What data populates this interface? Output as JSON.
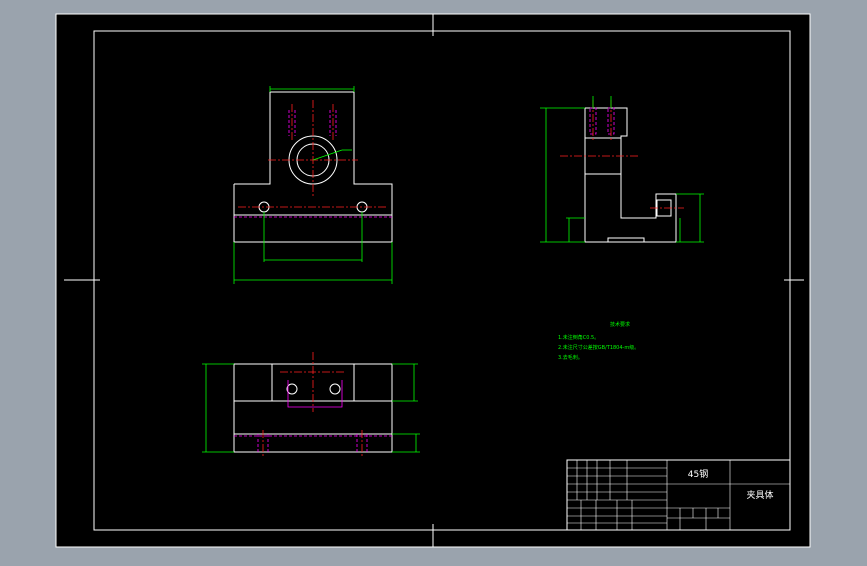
{
  "colors": {
    "window_bg": "#9aa3ad",
    "sheet_bg": "#000000",
    "outline": "#ffffff",
    "dimension": "#00ff00",
    "centerline": "#ff2020",
    "hidden": "#ff00ff"
  },
  "title_block": {
    "material": "45钢",
    "part_name": "夹具体"
  },
  "tech_notes": {
    "heading": "技术要求",
    "lines": [
      "1.未注倒角C0.5。",
      "2.未注尺寸公差按GB/T1804-m级。",
      "3.去毛刺。"
    ]
  }
}
